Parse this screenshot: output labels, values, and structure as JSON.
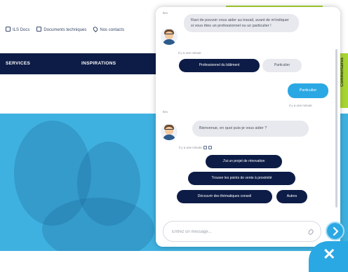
{
  "site": {
    "utility_links": [
      {
        "label": "ILS Docs",
        "icon": "document-icon"
      },
      {
        "label": "Documents techniques",
        "icon": "folder-icon"
      },
      {
        "label": "Nos contacts",
        "icon": "location-pin-icon"
      }
    ],
    "nav": [
      {
        "label": "SERVICES"
      },
      {
        "label": "INSPIRATIONS"
      }
    ],
    "side_tab": {
      "label": "Commentaires"
    },
    "colors": {
      "navy": "#0d1c46",
      "accent_blue": "#2aa8e4",
      "lime": "#a9d633",
      "hero": "#3fb1e0"
    }
  },
  "chat": {
    "messages": [
      {
        "sender": "Ilex",
        "text": "Ravi de pouvoir vous aider au travail, avant de m'indiquer si vous êtes un professionnel ou un particulier !",
        "meta": "il y a une minute"
      },
      {
        "sender": "Ilex",
        "text": "Bienvenue, en quoi puis-je vous aider ?",
        "meta": "il y a une minute"
      }
    ],
    "choice_buttons_1": [
      {
        "label": "Professionnel du bâtiment"
      },
      {
        "label": "Particulier"
      }
    ],
    "user_reply": {
      "text": "Particulier",
      "meta": "il y a une minute"
    },
    "choice_buttons_2": [
      {
        "label": "J'ai un projet de rénovation"
      },
      {
        "label": "Trouver les points de vente à proximité"
      },
      {
        "label": "Découvrir des thématiques conseil"
      },
      {
        "label": "Autres"
      }
    ],
    "input": {
      "placeholder": "Entrez un message..."
    },
    "close_symbol": "✕"
  }
}
